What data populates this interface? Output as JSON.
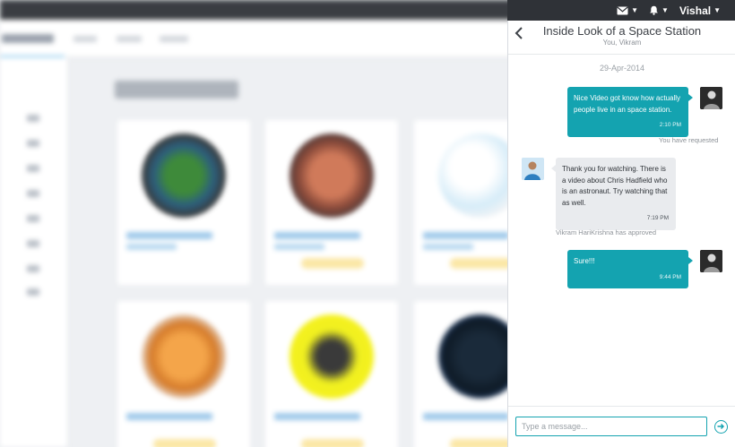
{
  "topbar": {
    "mail_icon": "mail-icon",
    "bell_icon": "bell-icon",
    "user_name": "Vishal"
  },
  "conversation": {
    "title": "Inside Look of a Space Station",
    "participants": "You, Vikram",
    "date": "29-Apr-2014",
    "messages": [
      {
        "direction": "out",
        "text": "Nice Video got know how actually people live in an space station.",
        "time": "2:10 PM",
        "status": "You have requested"
      },
      {
        "direction": "in",
        "text": "Thank you for watching. There is a video about Chris Hadfield who is an astronaut. Try watching that as well.",
        "time": "7:19 PM",
        "status": "Vikram HariKrishna has approved"
      },
      {
        "direction": "out",
        "text": "Sure!!!",
        "time": "9:44 PM"
      }
    ]
  },
  "composer": {
    "placeholder": "Type a message..."
  },
  "colors": {
    "accent": "#14a3b0",
    "incoming_bubble": "#e9ebee",
    "topbar": "#2f3237"
  }
}
